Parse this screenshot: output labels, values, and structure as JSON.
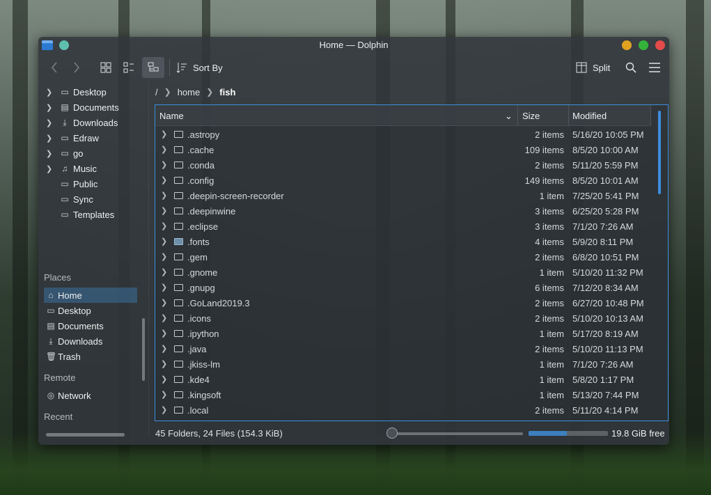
{
  "window": {
    "title": "Home — Dolphin"
  },
  "toolbar": {
    "sort_label": "Sort By",
    "split_label": "Split",
    "icons": [
      "back-icon",
      "forward-icon",
      "icons-view-icon",
      "compact-view-icon",
      "details-view-icon",
      "sort-icon",
      "split-icon",
      "search-icon",
      "hamburger-menu-icon"
    ]
  },
  "folder_tree": [
    {
      "label": "Desktop",
      "icon": "desktop-icon",
      "expandable": true
    },
    {
      "label": "Documents",
      "icon": "documents-icon",
      "expandable": true
    },
    {
      "label": "Downloads",
      "icon": "downloads-icon",
      "expandable": true
    },
    {
      "label": "Edraw",
      "icon": "folder-icon",
      "expandable": true
    },
    {
      "label": "go",
      "icon": "folder-icon",
      "expandable": true
    },
    {
      "label": "Music",
      "icon": "music-icon",
      "expandable": true
    },
    {
      "label": "Public",
      "icon": "folder-icon",
      "expandable": false
    },
    {
      "label": "Sync",
      "icon": "folder-icon",
      "expandable": false
    },
    {
      "label": "Templates",
      "icon": "folder-icon",
      "expandable": false
    }
  ],
  "places": {
    "title": "Places",
    "items": [
      {
        "label": "Home",
        "icon": "home-icon",
        "selected": true
      },
      {
        "label": "Desktop",
        "icon": "desktop-icon"
      },
      {
        "label": "Documents",
        "icon": "documents-icon"
      },
      {
        "label": "Downloads",
        "icon": "downloads-icon"
      },
      {
        "label": "Trash",
        "icon": "trash-icon"
      }
    ]
  },
  "remote": {
    "title": "Remote",
    "items": [
      {
        "label": "Network",
        "icon": "network-icon"
      }
    ]
  },
  "recent": {
    "title": "Recent"
  },
  "breadcrumb": [
    "/",
    "home",
    "fish"
  ],
  "table": {
    "headers": {
      "name": "Name",
      "size": "Size",
      "modified": "Modified"
    },
    "rows": [
      {
        "name": ".astropy",
        "size": "2 items",
        "modified": "5/16/20 10:05 PM"
      },
      {
        "name": ".cache",
        "size": "109 items",
        "modified": "8/5/20 10:00 AM"
      },
      {
        "name": ".conda",
        "size": "2 items",
        "modified": "5/11/20 5:59 PM"
      },
      {
        "name": ".config",
        "size": "149 items",
        "modified": "8/5/20 10:01 AM"
      },
      {
        "name": ".deepin-screen-recorder",
        "size": "1 item",
        "modified": "7/25/20 5:41 PM"
      },
      {
        "name": ".deepinwine",
        "size": "3 items",
        "modified": "6/25/20 5:28 PM"
      },
      {
        "name": ".eclipse",
        "size": "3 items",
        "modified": "7/1/20 7:26 AM"
      },
      {
        "name": ".fonts",
        "size": "4 items",
        "modified": "5/9/20 8:11 PM",
        "special": true
      },
      {
        "name": ".gem",
        "size": "2 items",
        "modified": "6/8/20 10:51 PM"
      },
      {
        "name": ".gnome",
        "size": "1 item",
        "modified": "5/10/20 11:32 PM"
      },
      {
        "name": ".gnupg",
        "size": "6 items",
        "modified": "7/12/20 8:34 AM"
      },
      {
        "name": ".GoLand2019.3",
        "size": "2 items",
        "modified": "6/27/20 10:48 PM"
      },
      {
        "name": ".icons",
        "size": "2 items",
        "modified": "5/10/20 10:13 AM"
      },
      {
        "name": ".ipython",
        "size": "1 item",
        "modified": "5/17/20 8:19 AM"
      },
      {
        "name": ".java",
        "size": "2 items",
        "modified": "5/10/20 11:13 PM"
      },
      {
        "name": ".jkiss-lm",
        "size": "1 item",
        "modified": "7/1/20 7:26 AM"
      },
      {
        "name": ".kde4",
        "size": "1 item",
        "modified": "5/8/20 1:17 PM"
      },
      {
        "name": ".kingsoft",
        "size": "1 item",
        "modified": "5/13/20 7:44 PM"
      },
      {
        "name": ".local",
        "size": "2 items",
        "modified": "5/11/20 4:14 PM"
      }
    ]
  },
  "status": {
    "summary": "45 Folders, 24 Files (154.3 KiB)",
    "free_space": "19.8 GiB free",
    "space_used_fraction": 0.48,
    "zoom_level_fraction": 0.0
  },
  "colors": {
    "accent": "#3d8ee0",
    "selection": "#3d7db4",
    "minimize": "#e0a121",
    "maximize": "#35b23a",
    "close": "#e34b4b"
  }
}
